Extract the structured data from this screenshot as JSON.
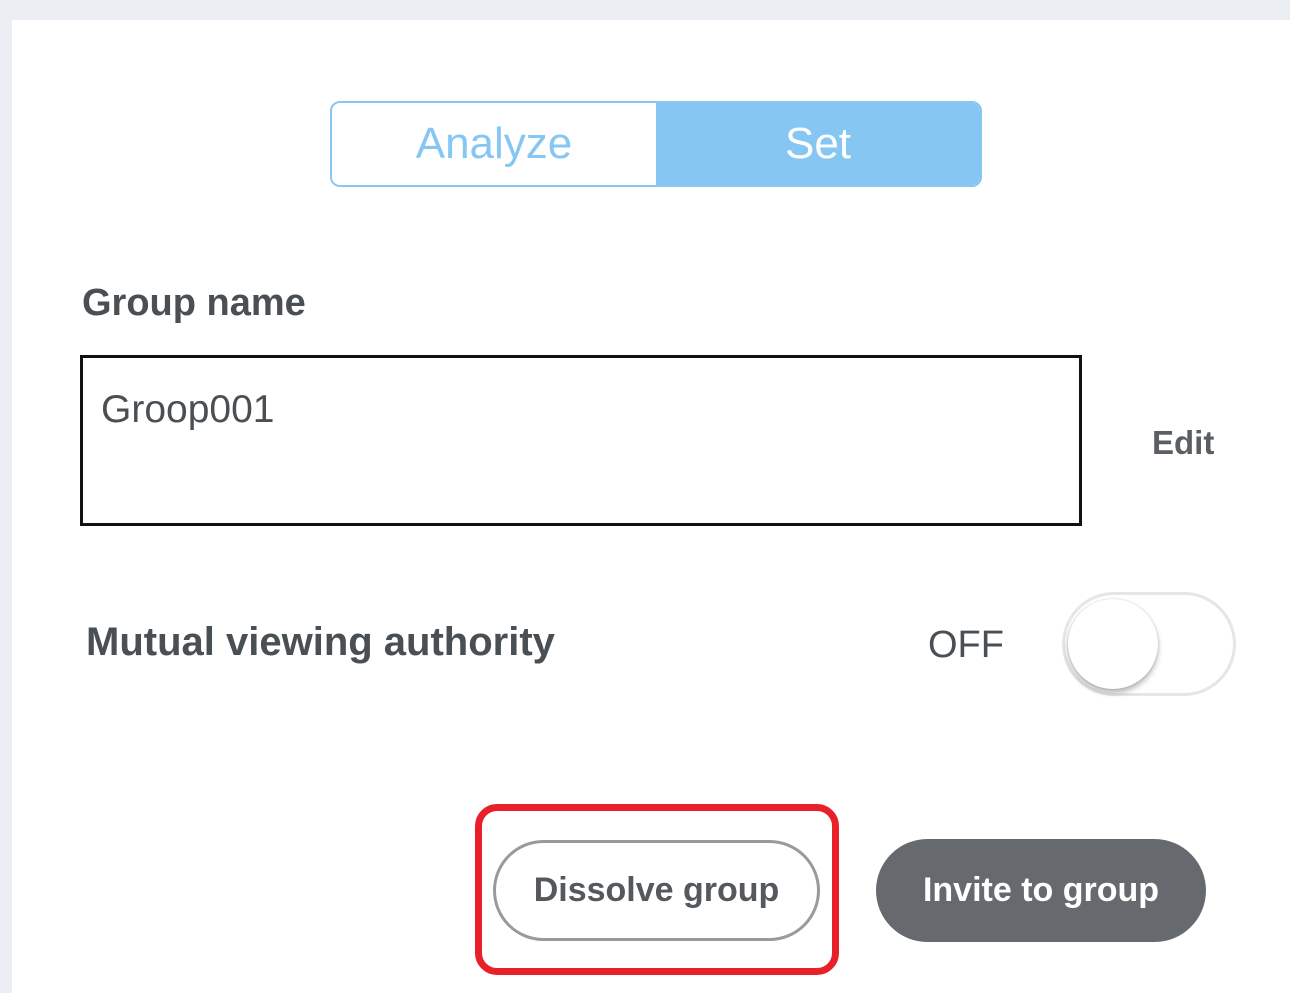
{
  "tabs": {
    "analyze_label": "Analyze",
    "set_label": "Set",
    "active": "Set"
  },
  "group_name": {
    "label": "Group name",
    "value": "Groop001",
    "edit_label": "Edit"
  },
  "mutual_viewing": {
    "label": "Mutual viewing authority",
    "state_label": "OFF",
    "enabled": false
  },
  "actions": {
    "dissolve_label": "Dissolve group",
    "invite_label": "Invite to group",
    "highlighted": "Dissolve group"
  },
  "colors": {
    "accent": "#86c6f3",
    "highlight": "#e8202a",
    "primary_button": "#666a6e"
  }
}
